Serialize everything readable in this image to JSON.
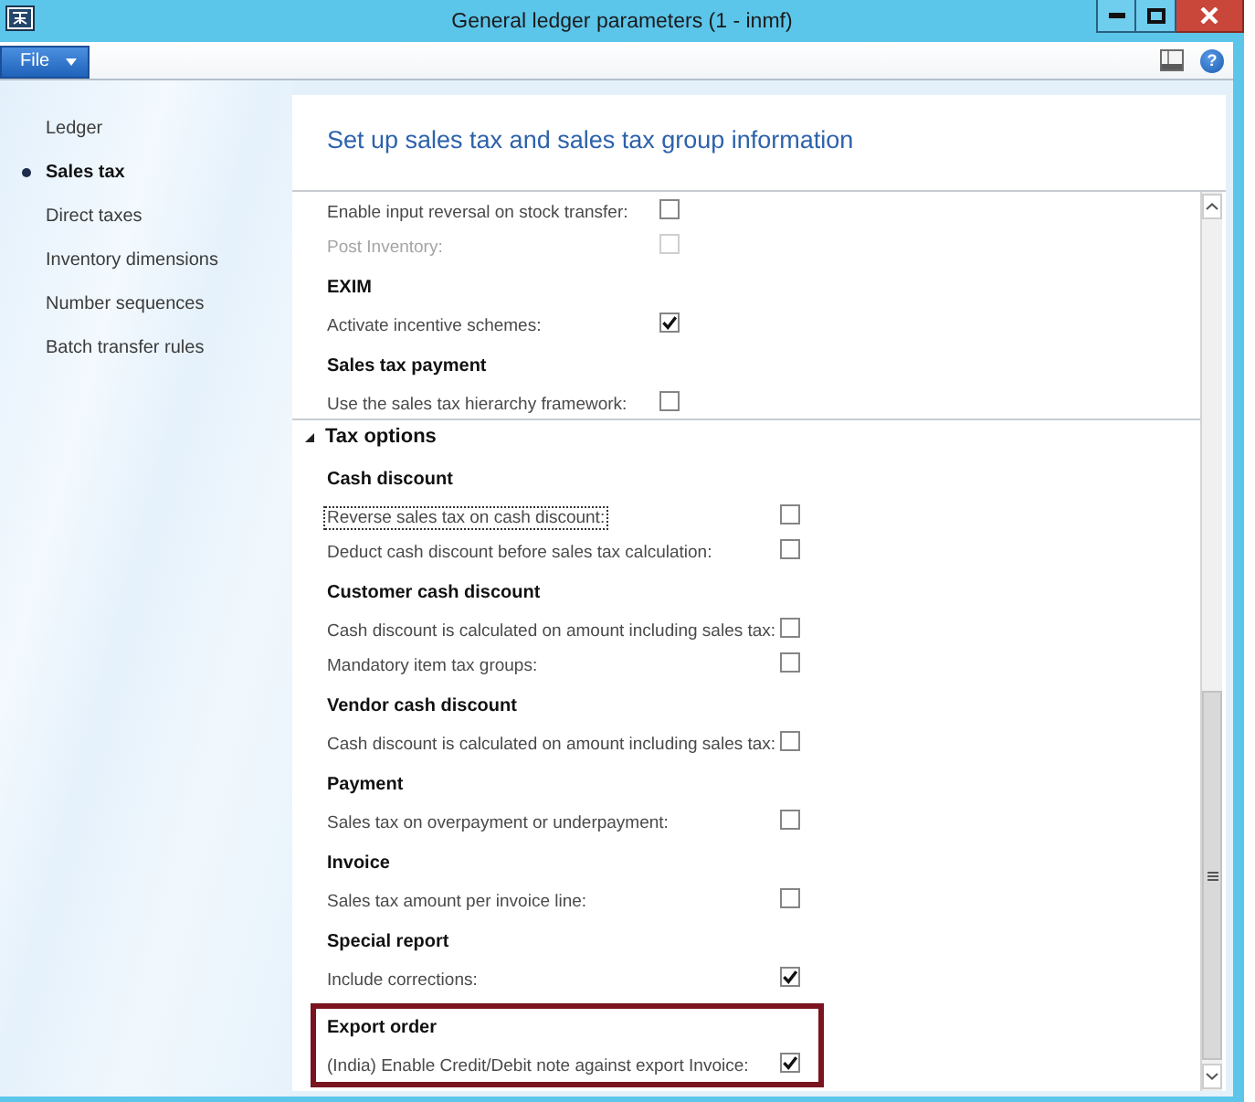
{
  "window": {
    "title": "General ledger parameters (1 - inmf)"
  },
  "menu": {
    "file_button": "File",
    "help_button": "?"
  },
  "sidebar": {
    "items": [
      {
        "label": "Ledger",
        "selected": false
      },
      {
        "label": "Sales tax",
        "selected": true
      },
      {
        "label": "Direct taxes",
        "selected": false
      },
      {
        "label": "Inventory dimensions",
        "selected": false
      },
      {
        "label": "Number sequences",
        "selected": false
      },
      {
        "label": "Batch transfer rules",
        "selected": false
      }
    ]
  },
  "content": {
    "heading": "Set up sales tax and sales tax group information",
    "sections": [
      {
        "groups": [
          {
            "highlighted": false,
            "fields": [
              {
                "label": "Enable input reversal on stock transfer:",
                "checked": false,
                "disabled": false,
                "focused": false
              },
              {
                "label": "Post Inventory:",
                "checked": false,
                "disabled": true,
                "focused": false
              }
            ]
          },
          {
            "title": "EXIM",
            "highlighted": false,
            "fields": [
              {
                "label": "Activate incentive schemes:",
                "checked": true,
                "disabled": false,
                "focused": false
              }
            ]
          },
          {
            "title": "Sales tax payment",
            "highlighted": false,
            "fields": [
              {
                "label": "Use the sales tax hierarchy framework:",
                "checked": false,
                "disabled": false,
                "focused": false
              }
            ]
          }
        ]
      },
      {
        "title": "Tax options",
        "expanded": true,
        "groups": [
          {
            "title": "Cash discount",
            "highlighted": false,
            "fields": [
              {
                "label": "Reverse sales tax on cash discount:",
                "checked": false,
                "disabled": false,
                "focused": true
              },
              {
                "label": "Deduct cash discount before sales tax calculation:",
                "checked": false,
                "disabled": false,
                "focused": false
              }
            ]
          },
          {
            "title": "Customer cash discount",
            "highlighted": false,
            "fields": [
              {
                "label": "Cash discount is calculated on amount including sales tax:",
                "checked": false,
                "disabled": false,
                "focused": false
              },
              {
                "label": "Mandatory item tax groups:",
                "checked": false,
                "disabled": false,
                "focused": false
              }
            ]
          },
          {
            "title": "Vendor cash discount",
            "highlighted": false,
            "fields": [
              {
                "label": "Cash discount is calculated on amount including sales tax:",
                "checked": false,
                "disabled": false,
                "focused": false
              }
            ]
          },
          {
            "title": "Payment",
            "highlighted": false,
            "fields": [
              {
                "label": "Sales tax on overpayment or underpayment:",
                "checked": false,
                "disabled": false,
                "focused": false
              }
            ]
          },
          {
            "title": "Invoice",
            "highlighted": false,
            "fields": [
              {
                "label": "Sales tax amount per invoice line:",
                "checked": false,
                "disabled": false,
                "focused": false
              }
            ]
          },
          {
            "title": "Special report",
            "highlighted": false,
            "fields": [
              {
                "label": "Include corrections:",
                "checked": true,
                "disabled": false,
                "focused": false
              }
            ]
          },
          {
            "title": "Export order",
            "highlighted": true,
            "fields": [
              {
                "label": "(India) Enable Credit/Debit note against export Invoice:",
                "checked": true,
                "disabled": false,
                "focused": false
              }
            ]
          }
        ]
      }
    ]
  }
}
